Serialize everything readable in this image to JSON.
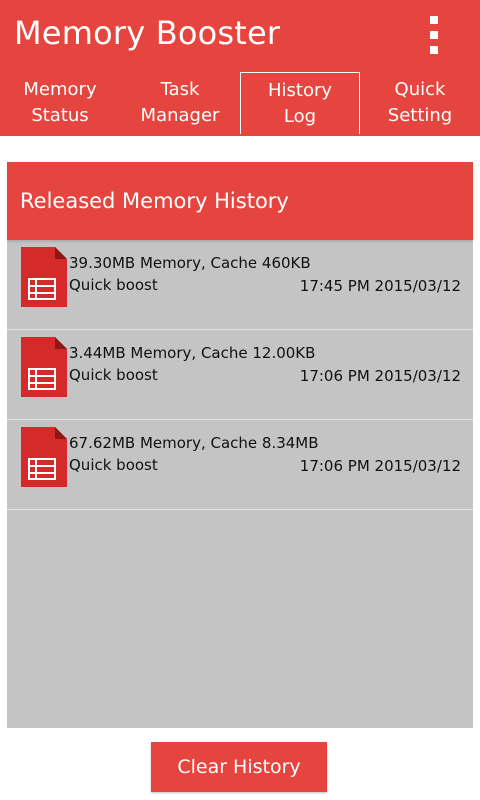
{
  "colors": {
    "accent": "#e6453f",
    "list_bg": "#c4c4c4",
    "icon_red": "#d42a2a"
  },
  "app": {
    "title": "Memory Booster",
    "menu_icon": "overflow-menu-icon"
  },
  "tabs": [
    {
      "label": "Memory\nStatus",
      "selected": false
    },
    {
      "label": "Task\nManager",
      "selected": false
    },
    {
      "label": "History\nLog",
      "selected": true
    },
    {
      "label": "Quick\nSetting",
      "selected": false
    }
  ],
  "panel": {
    "title": "Released Memory History",
    "rows": [
      {
        "icon": "spreadsheet-doc-icon",
        "title": "39.30MB Memory, Cache 460KB",
        "type": "Quick boost",
        "time": "17:45 PM 2015/03/12"
      },
      {
        "icon": "spreadsheet-doc-icon",
        "title": "3.44MB Memory, Cache 12.00KB",
        "type": "Quick boost",
        "time": "17:06 PM 2015/03/12"
      },
      {
        "icon": "spreadsheet-doc-icon",
        "title": "67.62MB Memory, Cache 8.34MB",
        "type": "Quick boost",
        "time": "17:06 PM 2015/03/12"
      }
    ]
  },
  "actions": {
    "clear_label": "Clear History"
  }
}
